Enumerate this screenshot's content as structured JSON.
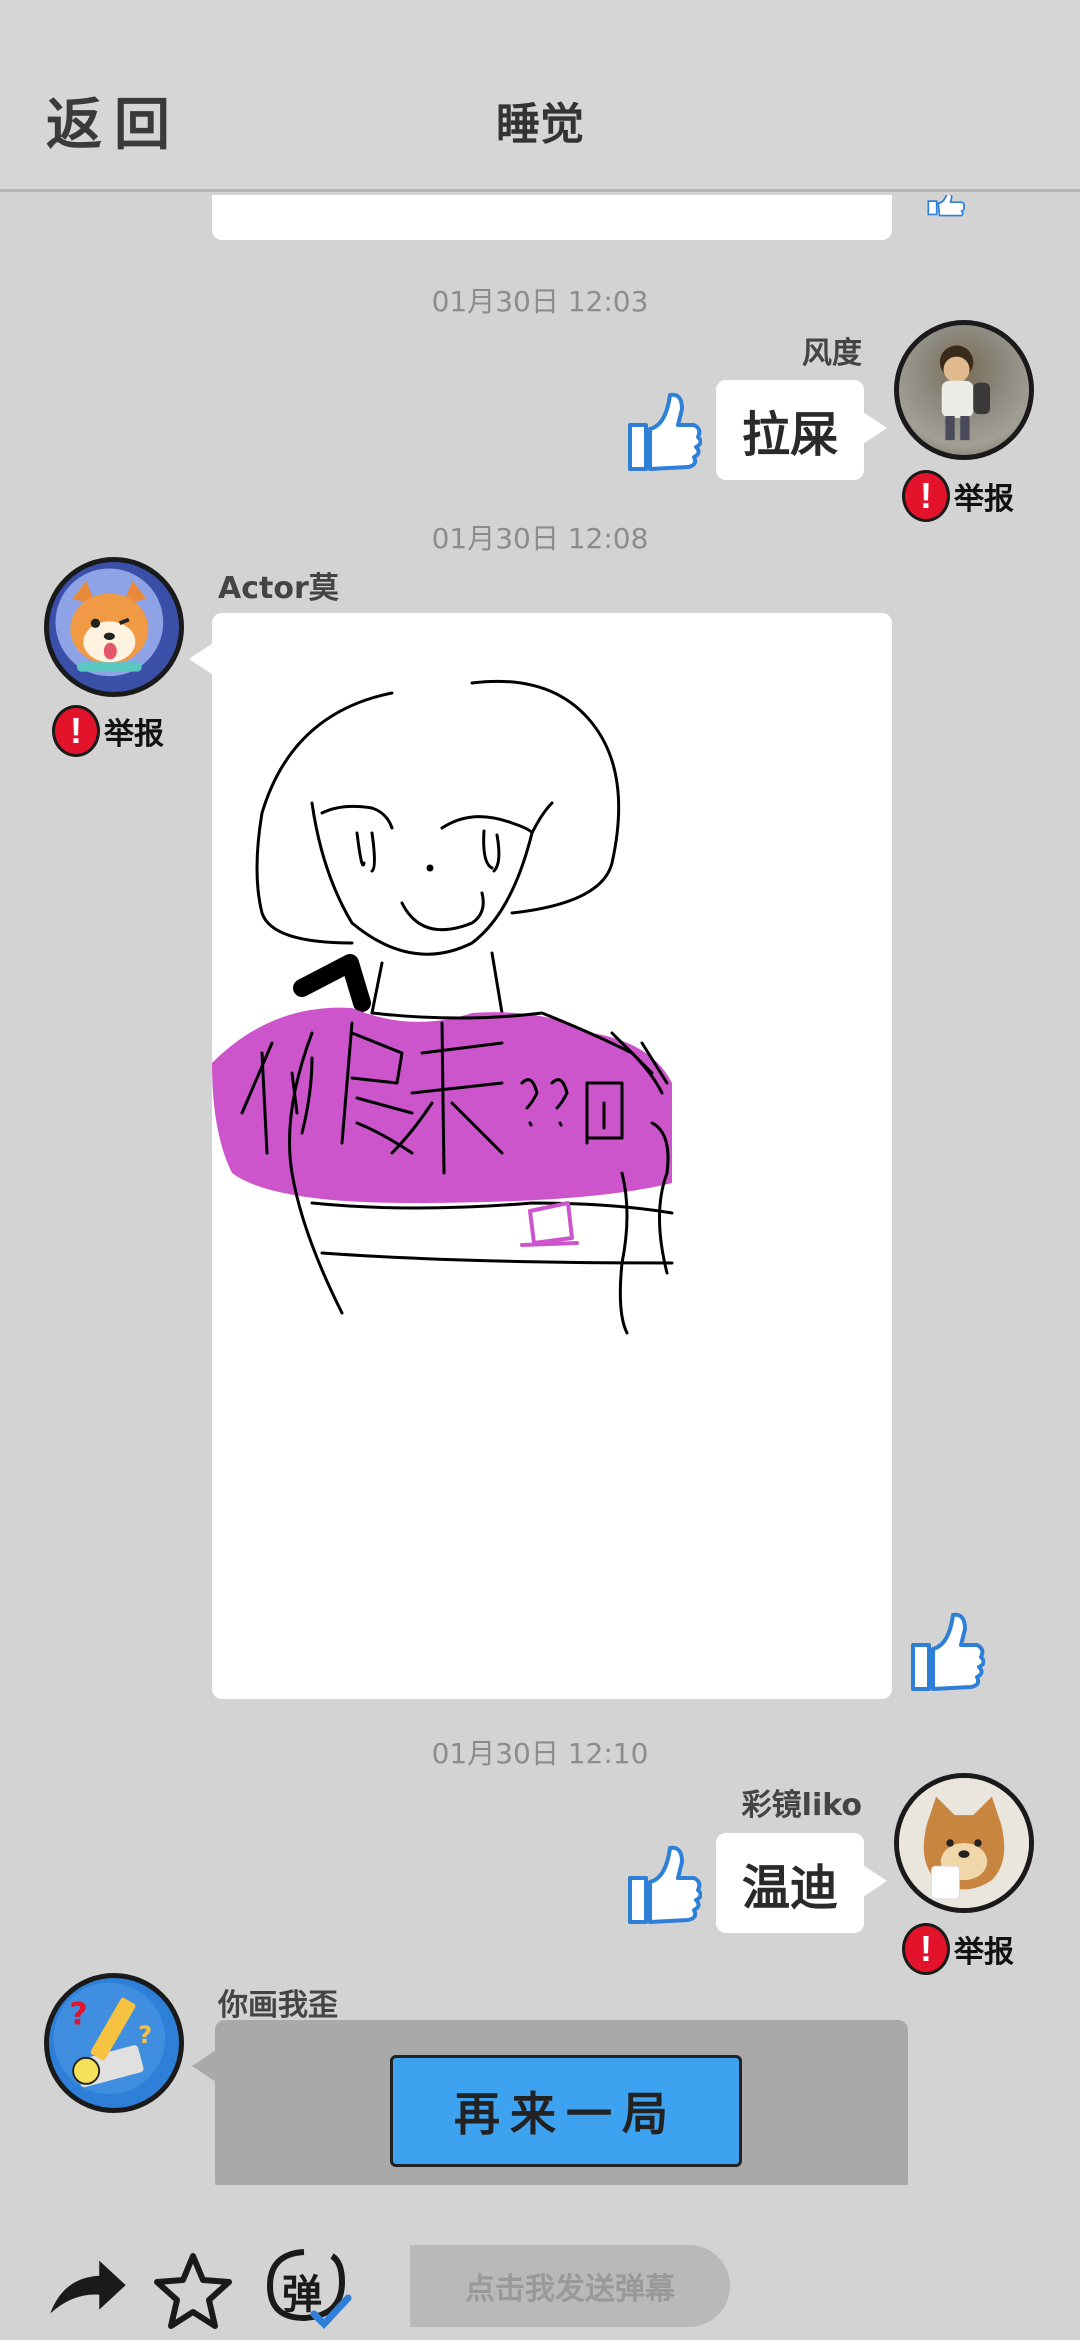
{
  "header": {
    "back_label": "返回",
    "title": "睡觉"
  },
  "messages": [
    {
      "timestamp": "01月30日  12:03",
      "user": "风度",
      "text": "拉屎",
      "report_label": "举报",
      "side": "right"
    },
    {
      "timestamp": "01月30日  12:08",
      "user": "Actor莫",
      "report_label": "举报",
      "side": "left",
      "drawing_text": "你是来??的"
    },
    {
      "timestamp": "01月30日  12:10",
      "user": "彩镜liko",
      "text": "温迪",
      "report_label": "举报",
      "side": "right"
    },
    {
      "user": "你画我歪",
      "button_label": "再来一局",
      "side": "left"
    }
  ],
  "bottom_bar": {
    "share_icon": "share-arrow-icon",
    "favorite_icon": "star-icon",
    "danmu_icon_label": "弹",
    "danmu_placeholder": "点击我发送弹幕"
  },
  "colors": {
    "background": "#d3d3d3",
    "like_blue": "#2d7fd8",
    "report_red": "#e3132b",
    "replay_blue": "#2d9cf5",
    "drawing_purple": "#cc55cc"
  }
}
